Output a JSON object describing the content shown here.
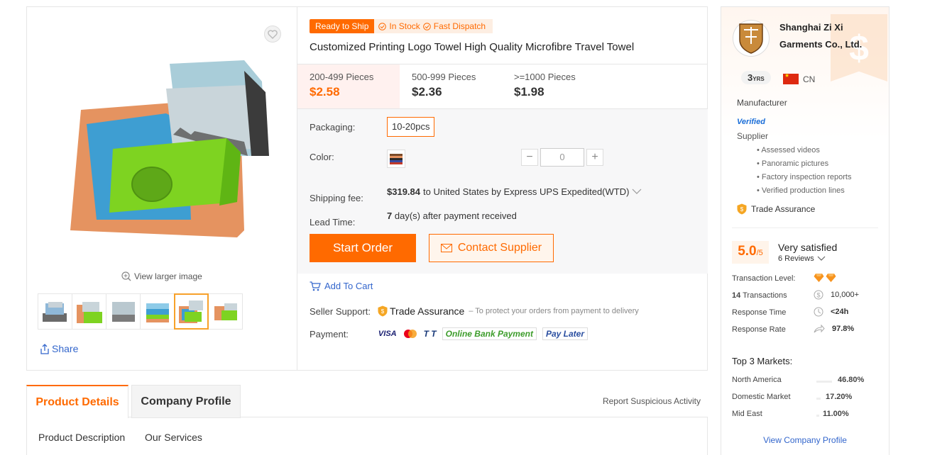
{
  "gallery": {
    "view_larger": "View larger image",
    "share": "Share",
    "thumb_count": 6,
    "active_thumb": 5
  },
  "badges": {
    "ready": "Ready to Ship",
    "in_stock": "In Stock",
    "fast_dispatch": "Fast Dispatch"
  },
  "product": {
    "title": "Customized Printing Logo Towel High Quality Microfibre Travel Towel"
  },
  "price_tiers": [
    {
      "range": "200-499 Pieces",
      "price": "$2.58"
    },
    {
      "range": "500-999 Pieces",
      "price": "$2.36"
    },
    {
      "range": ">=1000 Pieces",
      "price": "$1.98"
    }
  ],
  "attrs": {
    "packaging_label": "Packaging:",
    "packaging_value": "10-20pcs",
    "color_label": "Color:",
    "qty_value": "0",
    "qty_minus": "−",
    "qty_plus": "+",
    "shipping_label": "Shipping fee:",
    "shipping_amount": "$319.84",
    "shipping_desc": "to United States by Express UPS Expedited(WTD)",
    "lead_label": "Lead Time:",
    "lead_days": "7",
    "lead_desc": "day(s) after payment received"
  },
  "actions": {
    "start_order": "Start Order",
    "contact_supplier": "Contact Supplier",
    "add_to_cart": "Add To Cart"
  },
  "support": {
    "label": "Seller Support:",
    "trade_assurance": "Trade Assurance",
    "note": "– To protect your orders from payment to delivery"
  },
  "payment": {
    "label": "Payment:",
    "visa": "VISA",
    "tt": "T T",
    "online_bank": "Online Bank Payment",
    "pay_later": "Pay Later"
  },
  "tabs": {
    "product_details": "Product Details",
    "company_profile": "Company Profile",
    "report": "Report Suspicious Activity",
    "product_description": "Product Description",
    "our_services": "Our Services"
  },
  "supplier": {
    "name": "Shanghai Zi Xi Garments Co., Ltd.",
    "years_num": "3",
    "years_unit": "YRS",
    "country": "CN",
    "type": "Manufacturer",
    "verified": "Verified",
    "supplier_label": "Supplier",
    "verifications": [
      "Assessed videos",
      "Panoramic pictures",
      "Factory inspection reports",
      "Verified production lines"
    ],
    "trade_assurance": "Trade Assurance",
    "score": "5.0",
    "score_den": "/5",
    "satisfaction": "Very satisfied",
    "reviews": "6 Reviews",
    "transaction_level_label": "Transaction Level:",
    "transactions_count": "14",
    "transactions_label": "Transactions",
    "transactions_value": "10,000+",
    "response_time_label": "Response Time",
    "response_time_value": "<24h",
    "response_rate_label": "Response Rate",
    "response_rate_value": "97.8%",
    "markets_title": "Top 3 Markets:",
    "markets": [
      {
        "name": "North America",
        "share": "46.80%",
        "fraction": 0.468
      },
      {
        "name": "Domestic Market",
        "share": "17.20%",
        "fraction": 0.172
      },
      {
        "name": "Mid East",
        "share": "11.00%",
        "fraction": 0.11
      }
    ],
    "view_profile": "View Company Profile"
  },
  "colors": {
    "accent": "#ff6a00",
    "link": "#3366cc",
    "diamond": "#f7931e"
  }
}
